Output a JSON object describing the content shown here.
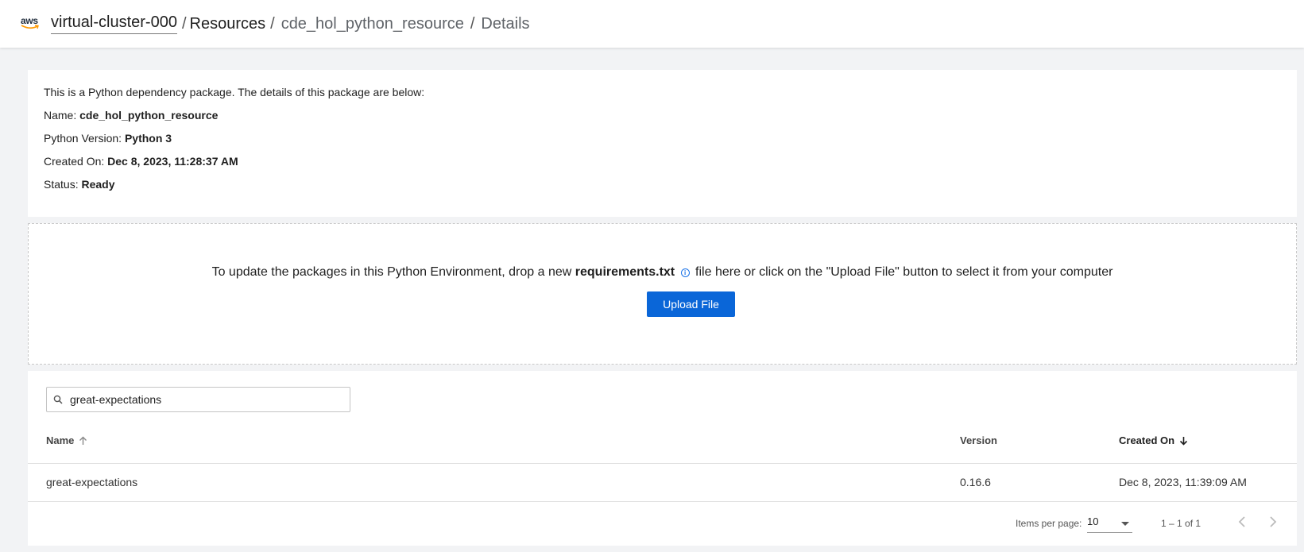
{
  "header": {
    "logo_text": "aws",
    "cluster": "virtual-cluster-000",
    "crumb_resources": "Resources",
    "crumb_resource": "cde_hol_python_resource",
    "crumb_details": "Details",
    "separator": "/"
  },
  "details": {
    "intro": "This is a Python dependency package. The details of this package are below:",
    "name_label": "Name:",
    "name_value": "cde_hol_python_resource",
    "python_label": "Python Version:",
    "python_value": "Python 3",
    "created_label": "Created On:",
    "created_value": "Dec 8, 2023, 11:28:37 AM",
    "status_label": "Status:",
    "status_value": "Ready"
  },
  "dropzone": {
    "text_before": "To update the packages in this Python Environment, drop a new",
    "file_name": "requirements.txt",
    "text_after": "file here or click on the \"Upload File\" button to select it from your computer",
    "upload_label": "Upload File"
  },
  "search": {
    "value": "great-expectations"
  },
  "table": {
    "columns": {
      "name": "Name",
      "version": "Version",
      "created": "Created On"
    },
    "rows": [
      {
        "name": "great-expectations",
        "version": "0.16.6",
        "created": "Dec 8, 2023, 11:39:09 AM"
      }
    ]
  },
  "paginator": {
    "items_per_page_label": "Items per page:",
    "items_per_page": "10",
    "range": "1 – 1 of 1"
  },
  "colors": {
    "accent": "#0a66d8",
    "background": "#f2f3f5"
  },
  "icons": [
    "aws-logo",
    "info-icon",
    "search-icon",
    "sort-asc-icon",
    "sort-desc-icon",
    "dropdown-caret-icon",
    "chevron-left-icon",
    "chevron-right-icon"
  ]
}
